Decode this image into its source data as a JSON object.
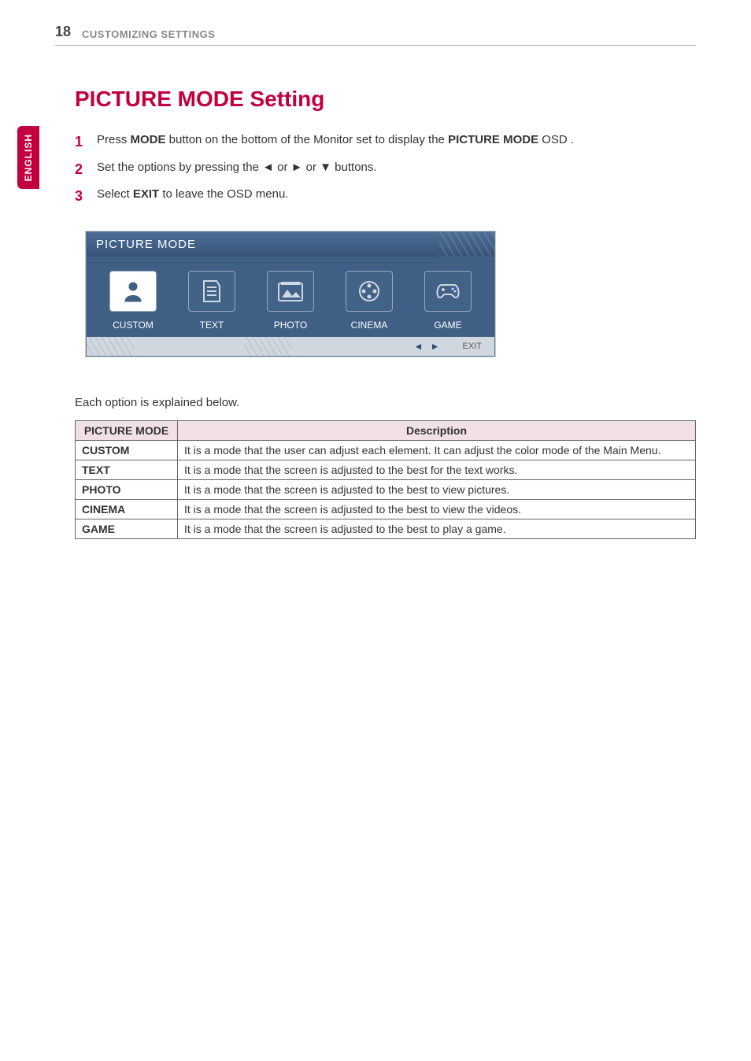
{
  "header": {
    "page_number": "18",
    "section": "CUSTOMIZING SETTINGS"
  },
  "side_tab": "ENGLISH",
  "title": "PICTURE MODE Setting",
  "steps": [
    {
      "num": "1",
      "text_parts": [
        "Press ",
        "MODE",
        " button on the bottom of the Monitor set to display the ",
        "PICTURE MODE",
        " OSD ."
      ]
    },
    {
      "num": "2",
      "text_parts": [
        "Set the options by pressing the ◄ or ► or ▼  buttons."
      ]
    },
    {
      "num": "3",
      "text_parts": [
        "Select ",
        "EXIT",
        " to leave the OSD menu."
      ]
    }
  ],
  "osd": {
    "title": "PICTURE  MODE",
    "modes": [
      {
        "label": "CUSTOM",
        "icon": "custom-icon",
        "selected": true
      },
      {
        "label": "TEXT",
        "icon": "text-icon",
        "selected": false
      },
      {
        "label": "PHOTO",
        "icon": "photo-icon",
        "selected": false
      },
      {
        "label": "CINEMA",
        "icon": "cinema-icon",
        "selected": false
      },
      {
        "label": "GAME",
        "icon": "game-icon",
        "selected": false
      }
    ],
    "footer": {
      "arrows": "◄  ►",
      "exit": "EXIT"
    }
  },
  "explain_line": "Each option is explained below.",
  "table": {
    "headers": [
      "PICTURE MODE",
      "Description"
    ],
    "rows": [
      {
        "mode": "CUSTOM",
        "desc": "It is a mode that the user can adjust each element. It can adjust the color mode of the Main Menu."
      },
      {
        "mode": "TEXT",
        "desc": "It is a mode that the screen is adjusted to the best for the text works."
      },
      {
        "mode": "PHOTO",
        "desc": "It is a mode that the screen is adjusted to the best to view pictures."
      },
      {
        "mode": "CINEMA",
        "desc": "It is a mode that the screen is adjusted to the best to view the videos."
      },
      {
        "mode": "GAME",
        "desc": "It is a mode that the screen is adjusted to the best to play a game."
      }
    ]
  }
}
